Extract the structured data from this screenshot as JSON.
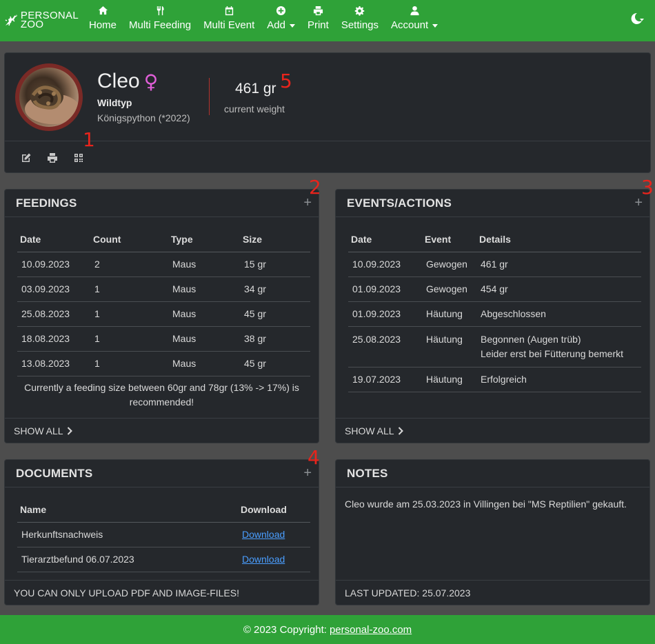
{
  "nav": {
    "brand_line1": "PERSONAL",
    "brand_line2": "ZOO",
    "items": [
      {
        "label": "Home",
        "icon": "home-icon"
      },
      {
        "label": "Multi Feeding",
        "icon": "utensils-icon"
      },
      {
        "label": "Multi Event",
        "icon": "calendar-icon"
      },
      {
        "label": "Add",
        "icon": "plus-circle-icon",
        "dropdown": true
      },
      {
        "label": "Print",
        "icon": "printer-icon"
      },
      {
        "label": "Settings",
        "icon": "gear-icon"
      },
      {
        "label": "Account",
        "icon": "user-icon",
        "dropdown": true
      }
    ]
  },
  "profile": {
    "name": "Cleo",
    "gender_symbol": "♀",
    "morph": "Wildtyp",
    "species": "Königspython (*2022)",
    "weight": "461 gr",
    "weight_label": "current weight"
  },
  "annotations": [
    "1",
    "2",
    "3",
    "4",
    "5"
  ],
  "feedings": {
    "title": "FEEDINGS",
    "columns": [
      "Date",
      "Count",
      "Type",
      "Size"
    ],
    "rows": [
      [
        "10.09.2023",
        "2",
        "Maus",
        "15 gr"
      ],
      [
        "03.09.2023",
        "1",
        "Maus",
        "34 gr"
      ],
      [
        "25.08.2023",
        "1",
        "Maus",
        "45 gr"
      ],
      [
        "18.08.2023",
        "1",
        "Maus",
        "38 gr"
      ],
      [
        "13.08.2023",
        "1",
        "Maus",
        "45 gr"
      ]
    ],
    "recommendation_line1": "Currently a feeding size between 60gr and 78gr (13% -> 17%) is",
    "recommendation_line2": "recommended!",
    "show_all": "SHOW ALL"
  },
  "events": {
    "title": "EVENTS/ACTIONS",
    "columns": [
      "Date",
      "Event",
      "Details"
    ],
    "rows": [
      {
        "date": "10.09.2023",
        "event": "Gewogen",
        "details": "461 gr"
      },
      {
        "date": "01.09.2023",
        "event": "Gewogen",
        "details": "454 gr"
      },
      {
        "date": "01.09.2023",
        "event": "Häutung",
        "details": "Abgeschlossen"
      },
      {
        "date": "25.08.2023",
        "event": "Häutung",
        "details": "Begonnen (Augen trüb)",
        "details2": "Leider erst bei Fütterung bemerkt"
      },
      {
        "date": "19.07.2023",
        "event": "Häutung",
        "details": "Erfolgreich"
      }
    ],
    "show_all": "SHOW ALL"
  },
  "documents": {
    "title": "DOCUMENTS",
    "columns": [
      "Name",
      "Download"
    ],
    "rows": [
      {
        "name": "Herkunftsnachweis",
        "link": "Download"
      },
      {
        "name": "Tierarztbefund 06.07.2023",
        "link": "Download"
      }
    ],
    "footer": "YOU CAN ONLY UPLOAD PDF AND IMAGE-FILES!"
  },
  "notes": {
    "title": "NOTES",
    "text": "Cleo wurde am 25.03.2023 in Villingen bei \"MS Reptilien\" gekauft.",
    "footer": "LAST UPDATED: 25.07.2023"
  },
  "footer": {
    "copyright": "© 2023 Copyright:",
    "link": "personal-zoo.com"
  },
  "colors": {
    "brand_green": "#2fa238",
    "card_bg": "#25282c",
    "annotation_red": "#e8241c",
    "female_pink": "#e05fd8",
    "link_blue": "#4a9eff"
  }
}
